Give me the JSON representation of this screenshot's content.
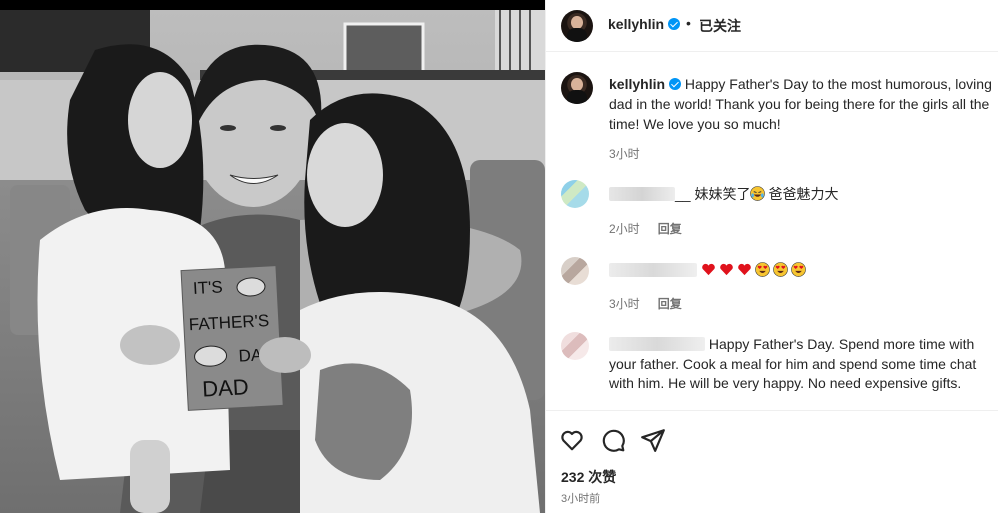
{
  "post": {
    "username": "kellyhlin",
    "follow_status": "已关注",
    "separator": "•",
    "caption": "Happy Father's Day to the most humorous, loving dad in the world! Thank you for being there for the girls all the time! We love you so much!",
    "caption_time": "3小时",
    "card_text": [
      "IT'S",
      "FATHER'S",
      "DA",
      "DAD"
    ]
  },
  "comments": [
    {
      "text": "妹妹笑了",
      "suffix": "爸爸魅力大",
      "prefix": "__",
      "time": "2小时",
      "reply": "回复"
    },
    {
      "text": "",
      "time": "3小时",
      "reply": "回复"
    },
    {
      "text": "Happy Father's Day. Spend more time with your father. Cook a meal for him and spend some time chat with him. He will be very happy. No need expensive gifts.",
      "time": "",
      "reply": ""
    }
  ],
  "footer": {
    "likes": "232 次赞",
    "posted_time": "3小时前"
  },
  "icons": {
    "like": "heart-icon",
    "comment": "comment-bubble-icon",
    "share": "paper-plane-icon",
    "verified": "verified-badge-icon"
  },
  "colors": {
    "verified": "#0095f6",
    "heart": "#e0121c",
    "muted": "#737373",
    "text": "#262626"
  }
}
